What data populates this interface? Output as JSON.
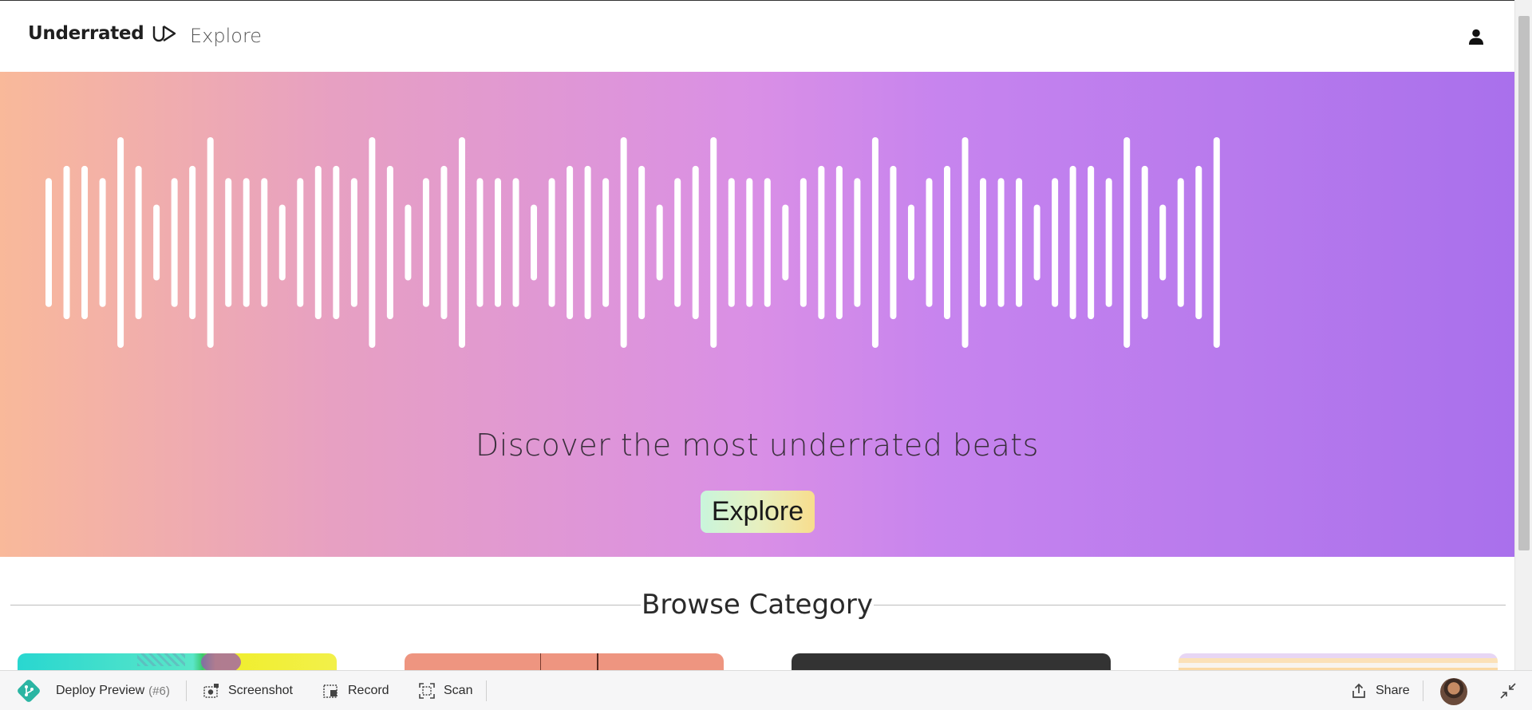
{
  "header": {
    "brand": "Underrated",
    "brand_logo_icon": "underrated-logo-icon",
    "nav_explore": "Explore",
    "user_icon": "user-icon"
  },
  "hero": {
    "title": "Discover the most underrated beats",
    "button_label": "Explore",
    "gradient_colors": [
      "#f9b99a",
      "#e7a0c2",
      "#d98fe6",
      "#a970ec"
    ],
    "button_gradient": [
      "#c9f5dc",
      "#f8dd8d"
    ]
  },
  "browse": {
    "title": "Browse Category",
    "cards": [
      {
        "name": "category-card-1"
      },
      {
        "name": "category-card-2"
      },
      {
        "name": "category-card-3"
      },
      {
        "name": "category-card-4"
      }
    ]
  },
  "toolbar": {
    "deploy_label": "Deploy Preview",
    "deploy_number": "(#6)",
    "screenshot_label": "Screenshot",
    "record_label": "Record",
    "scan_label": "Scan",
    "share_label": "Share"
  }
}
